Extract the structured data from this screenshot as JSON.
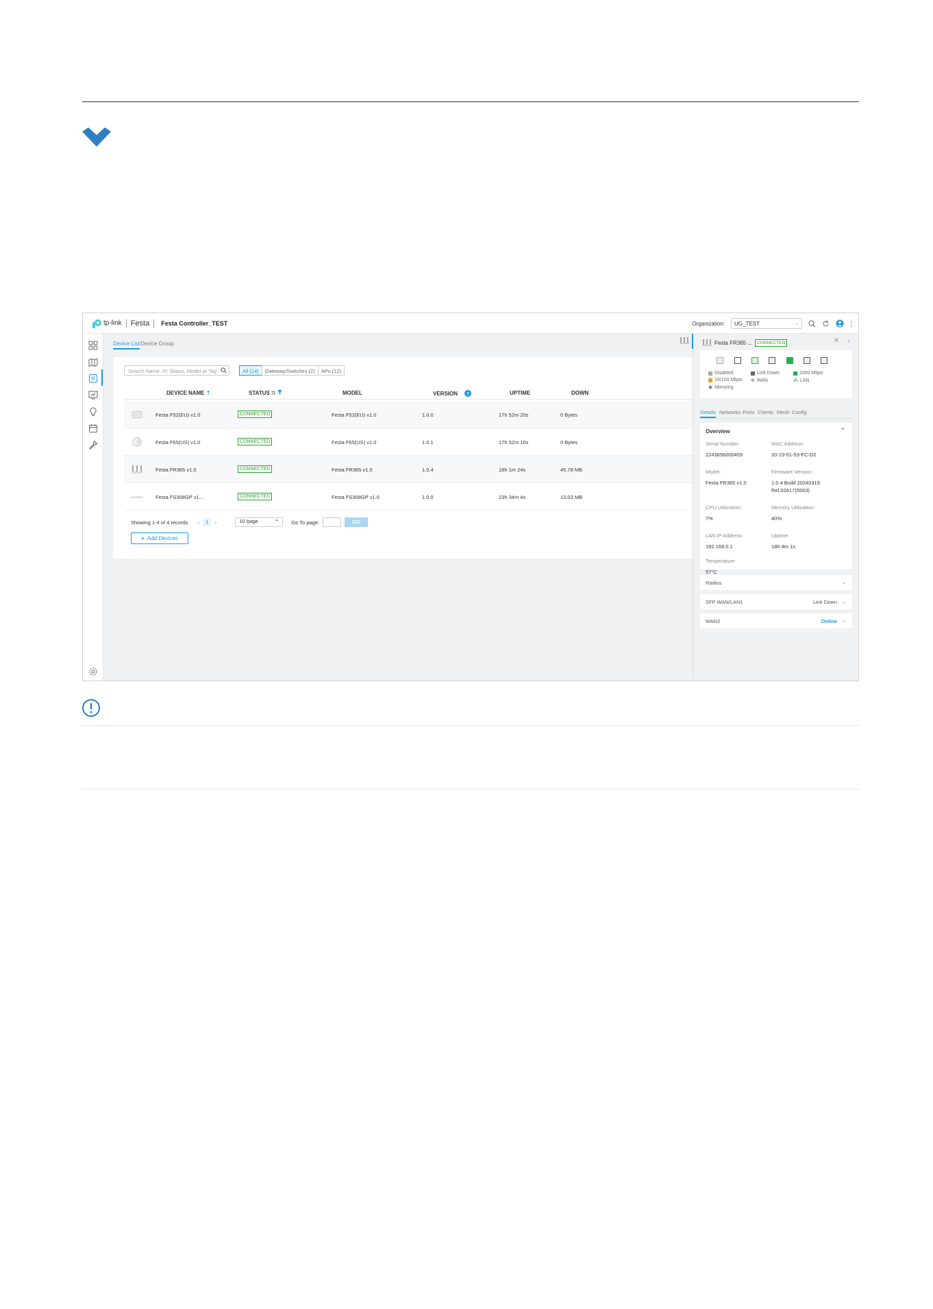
{
  "app": {
    "logo_text": "tp-link",
    "brand": "Festa",
    "controller_name": "Festa Controller_TEST",
    "organization_label": "Organization:",
    "organization_value": "UG_TEST"
  },
  "tabs": [
    "Device List",
    "Device Group"
  ],
  "search": {
    "placeholder": "Search Name, IP, Status, Model or Tag"
  },
  "filters": [
    "All (14)",
    "Gateway/Switches (2)",
    "APs (12)"
  ],
  "table": {
    "headers": [
      "DEVICE NAME",
      "STATUS",
      "MODEL",
      "VERSION",
      "UPTIME",
      "DOWN"
    ],
    "rows": [
      {
        "name": "Festa F52(EU) v1.0",
        "status": "CONNECTED",
        "model": "Festa F52(EU) v1.0",
        "version": "1.0.0",
        "uptime": "17h 52m 20s",
        "down": "0 Bytes"
      },
      {
        "name": "Festa F65(US) v1.0",
        "status": "CONNECTED",
        "model": "Festa F65(US) v1.0",
        "version": "1.0.1",
        "uptime": "17h 52m 10s",
        "down": "0 Bytes"
      },
      {
        "name": "Festa FR365 v1.0",
        "status": "CONNECTED",
        "model": "Festa FR365 v1.0",
        "version": "1.0.4",
        "uptime": "18h 1m 24s",
        "down": "45.78 MB"
      },
      {
        "name": "Festa FS308GP v1....",
        "status": "CONNECTED",
        "model": "Festa FS308GP v1.0",
        "version": "1.0.0",
        "uptime": "23h 34m 4s",
        "down": "13.03 MB"
      }
    ]
  },
  "pager": {
    "summary": "Showing 1-4 of 4 records",
    "current_page": "1",
    "per_page": "10 /page",
    "goto_label": "Go To page:",
    "go_label": "GO"
  },
  "add_devices_label": "Add Devices",
  "drawer": {
    "title": "Festa FR365 ...",
    "status": "CONNECTED",
    "legend": [
      "Disabled",
      "Link Down",
      "1000 Mbps",
      "10/100 Mbps",
      "WAN",
      "LAN",
      "Mirroring"
    ],
    "tabs": [
      "Details",
      "Networks",
      "Ports",
      "Clients",
      "Mesh",
      "Config"
    ],
    "overview_title": "Overview",
    "fields": [
      {
        "label": "Serial Number:",
        "value": "2243656000459"
      },
      {
        "label": "MAC Address:",
        "value": "20-23-51-53-FC-D2"
      },
      {
        "label": "Model:",
        "value": "Festa FR365 v1.0"
      },
      {
        "label": "Firmware Version:",
        "value": "1.0.4 Build 20240319 Rel.02617(5553)"
      },
      {
        "label": "CPU Utilization:",
        "value": "7%"
      },
      {
        "label": "Memory Utilization:",
        "value": "40%"
      },
      {
        "label": "LAN IP Address:",
        "value": "192.168.0.1"
      },
      {
        "label": "Uptime:",
        "value": "18h 4m 1s"
      },
      {
        "label": "Temperature:",
        "value": "57°C"
      }
    ],
    "sections": [
      {
        "title": "Radios",
        "status": ""
      },
      {
        "title": "SFP WAN/LAN1",
        "status": "Link Down"
      },
      {
        "title": "WAN2",
        "status": "Online"
      }
    ]
  },
  "colors": {
    "accent": "#1b9adf",
    "connected": "#2ca02c",
    "online": "#1b9adf",
    "port_active": "#22b14c"
  }
}
